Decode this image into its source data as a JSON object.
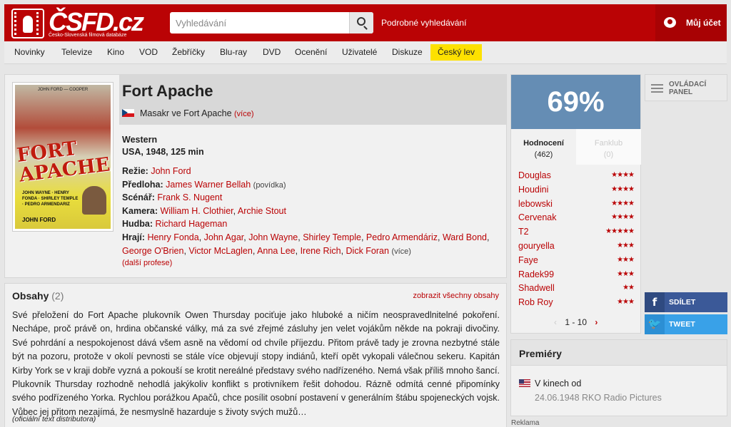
{
  "header": {
    "logo_text": "ČSFD.cz",
    "logo_sub": "Česko-Slovenská filmová databáze",
    "search_placeholder": "Vyhledávání",
    "advanced_search": "Podrobné vyhledávání",
    "account": "Můj účet"
  },
  "nav": {
    "items": [
      "Novinky",
      "Televize",
      "Kino",
      "VOD",
      "Žebříčky",
      "Blu-ray",
      "DVD",
      "Ocenění",
      "Uživatelé",
      "Diskuze",
      "Český lev"
    ]
  },
  "film": {
    "title": "Fort Apache",
    "alt_title": "Masakr ve Fort Apache",
    "alt_more": "(více)",
    "genre": "Western",
    "origin": "USA, 1948, 125 min",
    "poster": {
      "title": "FORT APACHE",
      "top_text": "JOHN FORD — COOPER",
      "names": "JOHN WAYNE · HENRY FONDA · SHIRLEY TEMPLE · PEDRO ARMENDARIZ",
      "director": "JOHN FORD"
    },
    "crew": {
      "directing_label": "Režie:",
      "directing": "John Ford",
      "source_label": "Předloha:",
      "source": "James Warner Bellah",
      "source_note": "(povídka)",
      "screenplay_label": "Scénář:",
      "screenplay": "Frank S. Nugent",
      "camera_label": "Kamera:",
      "camera": [
        "William H. Clothier",
        "Archie Stout"
      ],
      "music_label": "Hudba:",
      "music": "Richard Hageman",
      "cast_label": "Hrají:",
      "cast": [
        "Henry Fonda",
        "John Agar",
        "John Wayne",
        "Shirley Temple",
        "Pedro Armendáriz",
        "Ward Bond",
        "George O'Brien",
        "Victor McLaglen",
        "Anna Lee",
        "Irene Rich",
        "Dick Foran"
      ],
      "cast_more": "(více)",
      "more_professions": "(další profese)"
    }
  },
  "plot": {
    "title": "Obsahy",
    "count": "(2)",
    "show_all": "zobrazit všechny obsahy",
    "text": "Své přeložení do Fort Apache plukovník Owen Thursday pociťuje jako hluboké a ničím neospravedlnitelné pokoření. Nechápe, proč právě on, hrdina občanské války, má za své zřejmé zásluhy jen velet vojákům někde na pokraji divočiny. Své pohrdání a nespokojenost dává všem asně na vědomí od chvíle příjezdu. Přitom právě tady je zrovna nezbytné stále být na pozoru, protože v okolí pevnosti se stále více objevují stopy indiánů, kteří opět vykopali válečnou sekeru. Kapitán Kirby York se v kraji dobře vyzná a pokouší se krotit nereálné představy svého nadřízeného. Nemá však příliš mnoho šancí. Plukovník Thursday rozhodně nehodlá jakýkoliv konflikt s protivníkem řešit dohodou. Rázně odmítá cenné připomínky svého podřízeného Yorka. Rychlou porážkou Apačů, chce posílit osobní postavení v generálním štábu spojeneckých vojsk. Vůbec jej přitom nezajímá, že nesmyslně hazarduje s životy svých mužů…",
    "source": "(oficiální text distributora)"
  },
  "rating": {
    "value": "69%",
    "color": "#658db4",
    "tab_ratings": "Hodnocení",
    "tab_ratings_count": "(462)",
    "tab_fanclub": "Fanklub",
    "tab_fanclub_count": "(0)",
    "users": [
      {
        "name": "Douglas",
        "stars": "★★★★"
      },
      {
        "name": "Houdini",
        "stars": "★★★★"
      },
      {
        "name": "lebowski",
        "stars": "★★★★"
      },
      {
        "name": "Cervenak",
        "stars": "★★★★"
      },
      {
        "name": "T2",
        "stars": "★★★★★"
      },
      {
        "name": "gouryella",
        "stars": "★★★"
      },
      {
        "name": "Faye",
        "stars": "★★★"
      },
      {
        "name": "Radek99",
        "stars": "★★★"
      },
      {
        "name": "Shadwell",
        "stars": "★★"
      },
      {
        "name": "Rob Roy",
        "stars": "★★★"
      }
    ],
    "pager": "1 - 10"
  },
  "sidebar": {
    "control_panel": "OVLÁDACÍ PANEL",
    "share_fb": "SDÍLET",
    "share_tw": "TWEET"
  },
  "premiere": {
    "title": "Premiéry",
    "label": "V kinech od",
    "detail": "24.06.1948 RKO Radio Pictures"
  },
  "ads": "Reklama"
}
